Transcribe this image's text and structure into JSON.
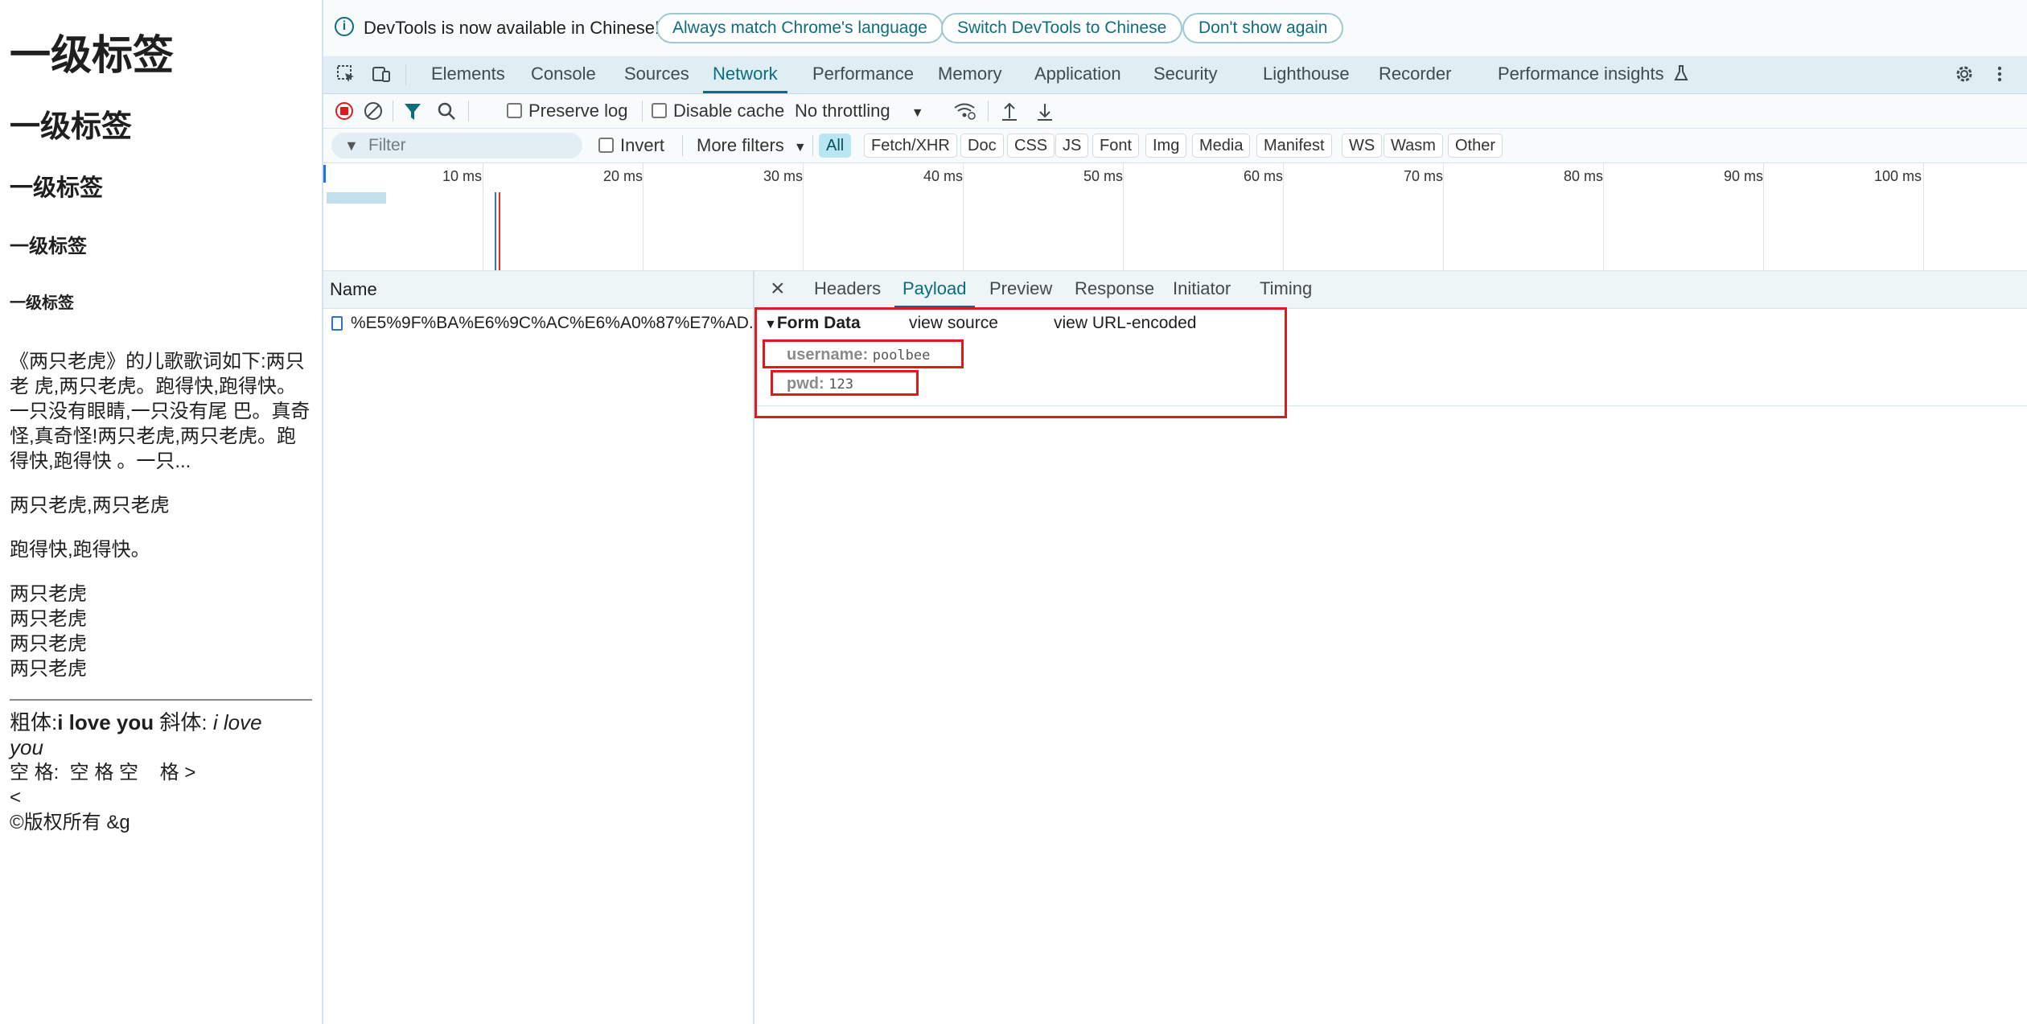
{
  "page": {
    "headings": [
      "一级标签",
      "一级标签",
      "一级标签",
      "一级标签",
      "一级标签"
    ],
    "paragraph1": [
      "《两只老虎》的儿歌歌词如下:两只",
      "老 虎,两只老虎。跑得快,跑得快。",
      "一只没有眼睛,一只没有尾 巴。真奇",
      "怪,真奇怪!两只老虎,两只老虎。跑",
      "得快,跑得快 。一只..."
    ],
    "paragraph2": "两只老虎,两只老虎",
    "paragraph3": "跑得快,跑得快。",
    "paragraph4": [
      "两只老虎",
      "两只老虎",
      "两只老虎",
      "两只老虎"
    ],
    "bold_prefix": "粗体:",
    "bold_text": "i love you",
    "italic_prefix": "斜体:",
    "italic_text_a": "i love",
    "italic_text_b": "you",
    "space_line": "空 格:  空 格 空    格 >",
    "lt_line": "<",
    "copyright_line": "©版权所有 &g"
  },
  "devtools": {
    "notice": {
      "message": "DevTools is now available in Chinese!",
      "btn_match": "Always match Chrome's language",
      "btn_switch": "Switch DevTools to Chinese",
      "btn_dont": "Don't show again"
    },
    "tabs": [
      "Elements",
      "Console",
      "Sources",
      "Network",
      "Performance",
      "Memory",
      "Application",
      "Security",
      "Lighthouse",
      "Recorder",
      "Performance insights"
    ],
    "active_tab": "Network",
    "toolbar": {
      "preserve_log": "Preserve log",
      "disable_cache": "Disable cache",
      "throttling": "No throttling"
    },
    "filter": {
      "placeholder": "Filter",
      "invert": "Invert",
      "more_filters": "More filters",
      "chips": [
        "All",
        "Fetch/XHR",
        "Doc",
        "CSS",
        "JS",
        "Font",
        "Img",
        "Media",
        "Manifest",
        "WS",
        "Wasm",
        "Other"
      ],
      "active_chip": "All"
    },
    "timeline": {
      "labels": [
        "10 ms",
        "20 ms",
        "30 ms",
        "40 ms",
        "50 ms",
        "60 ms",
        "70 ms",
        "80 ms",
        "90 ms",
        "100 ms"
      ]
    },
    "requests": {
      "column": "Name",
      "rows": [
        "%E5%9F%BA%E6%9C%AC%E6%A0%87%E7%AD..."
      ]
    },
    "detail": {
      "tabs": [
        "Headers",
        "Payload",
        "Preview",
        "Response",
        "Initiator",
        "Timing"
      ],
      "active_tab": "Payload",
      "form_data_title": "Form Data",
      "view_source": "view source",
      "view_url_encoded": "view URL-encoded",
      "fields": [
        {
          "key": "username:",
          "value": "poolbee"
        },
        {
          "key": "pwd:",
          "value": "123"
        }
      ]
    }
  }
}
